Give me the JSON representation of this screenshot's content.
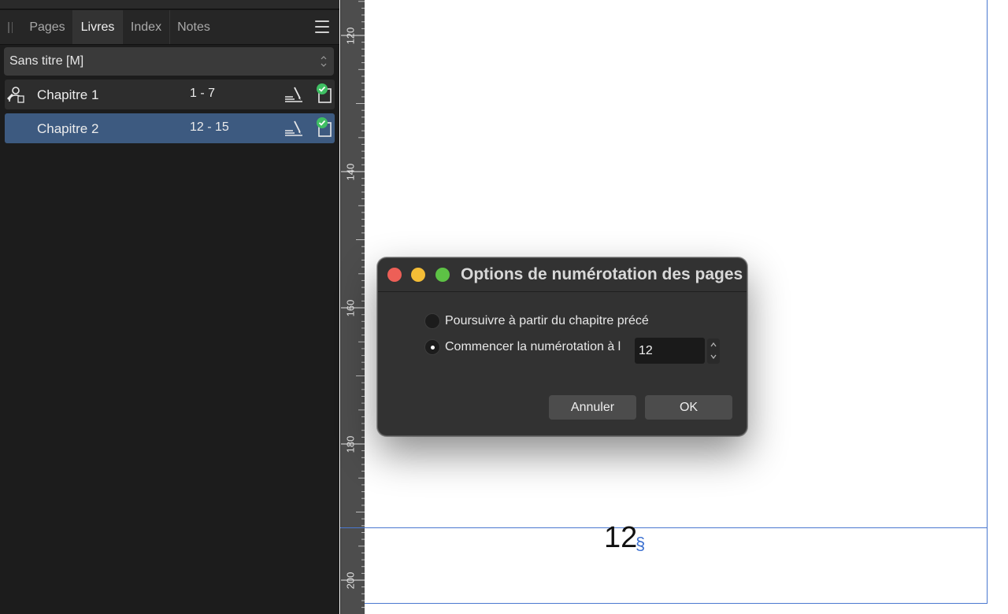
{
  "panel": {
    "tabs": [
      {
        "label": "Pages",
        "active": false
      },
      {
        "label": "Livres",
        "active": true
      },
      {
        "label": "Index",
        "active": false
      },
      {
        "label": "Notes",
        "active": false
      }
    ],
    "book_selector": {
      "value": "Sans titre [M]"
    },
    "chapters": [
      {
        "name": "Chapitre 1",
        "range": "1 - 7",
        "selected": false,
        "is_master": true
      },
      {
        "name": "Chapitre 2",
        "range": "12 - 15",
        "selected": true,
        "is_master": false
      }
    ]
  },
  "ruler": {
    "labels": [
      "120",
      "140",
      "160",
      "180",
      "200"
    ]
  },
  "canvas": {
    "page_number": "12",
    "section_marker": "§"
  },
  "dialog": {
    "title": "Options de numérotation des pages",
    "option_continue": "Poursuivre à partir du chapitre précé",
    "option_start_at": "Commencer la numérotation à l",
    "selected_option": "start_at",
    "start_value": "12",
    "cancel_label": "Annuler",
    "ok_label": "OK"
  },
  "colors": {
    "selection": "#3d5a80",
    "guide": "#4a78d0",
    "close": "#ed5f57",
    "minimize": "#f4bd36",
    "maximize": "#5dc245",
    "status_ok": "#3fbf63"
  }
}
